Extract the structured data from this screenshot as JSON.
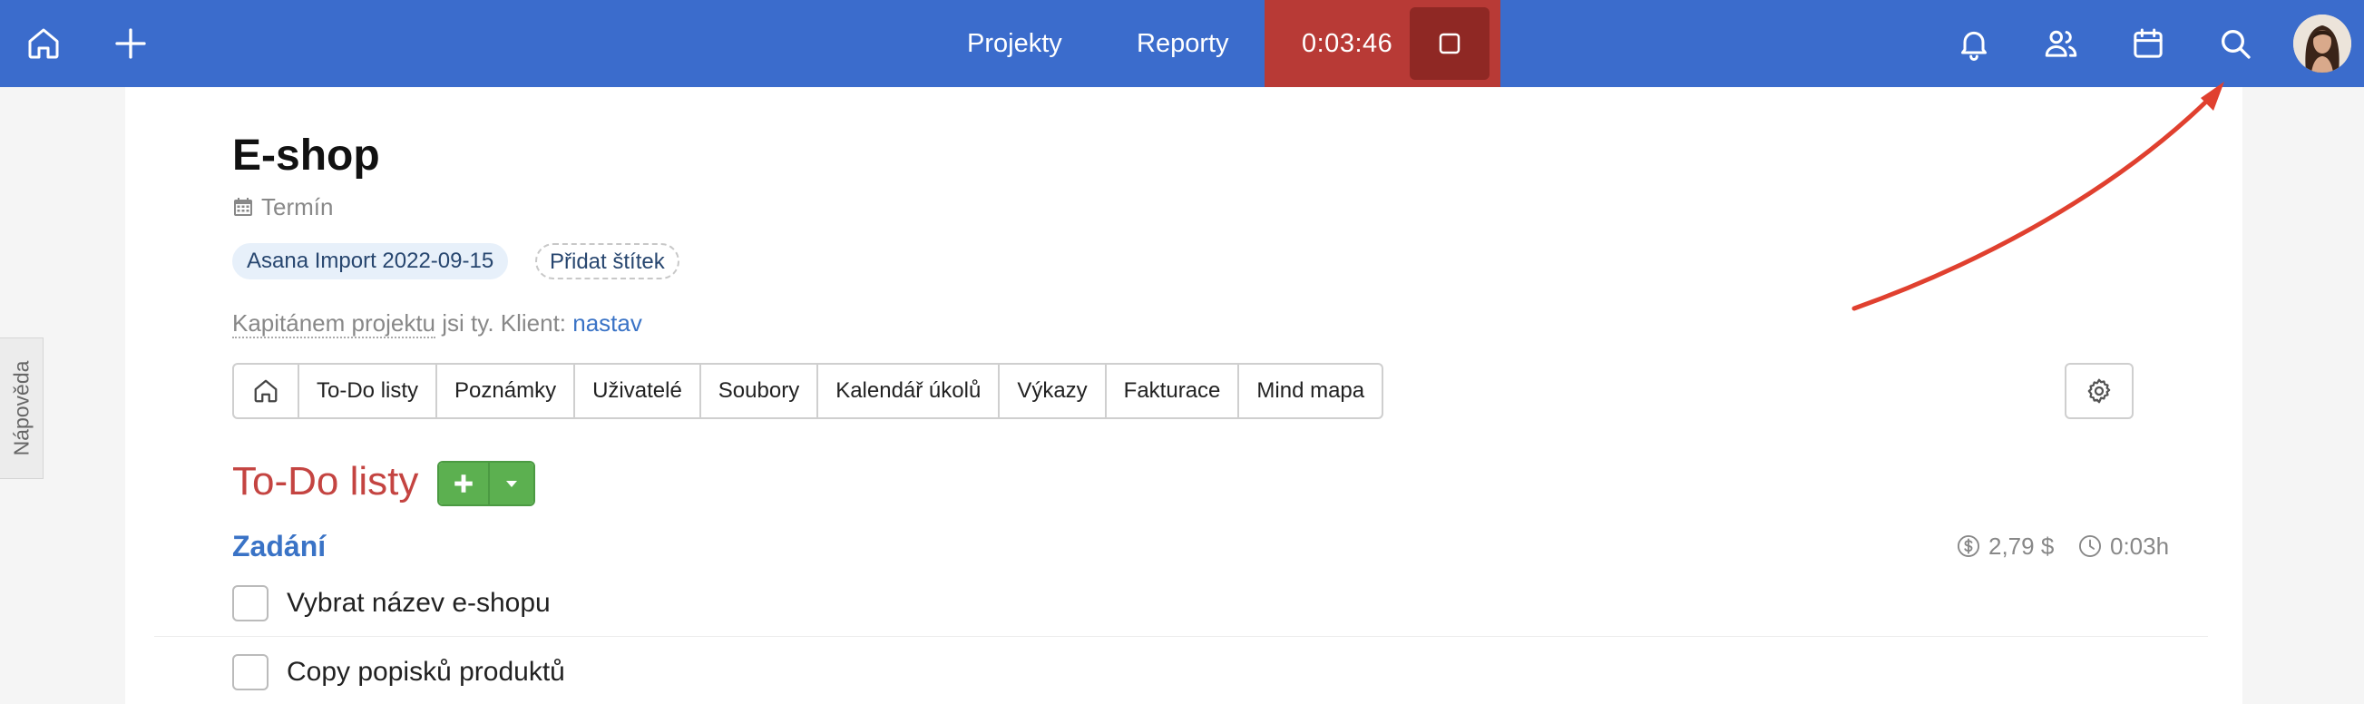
{
  "topbar": {
    "nav": [
      {
        "label": "Projekty"
      },
      {
        "label": "Reporty"
      }
    ],
    "timer": {
      "value": "0:03:46"
    },
    "icons": [
      "home-icon",
      "plus-icon",
      "stop-icon",
      "bell-icon",
      "users-icon",
      "calendar-icon",
      "search-icon"
    ]
  },
  "help": {
    "label": "Nápověda"
  },
  "project": {
    "title": "E-shop",
    "deadline_label": "Termín",
    "tags": [
      {
        "label": "Asana Import 2022-09-15"
      }
    ],
    "add_tag_label": "Přidat štítek",
    "captain_text": "Kapitánem projektu",
    "captain_rest": " jsi ty. Klient: ",
    "client_link": "nastav"
  },
  "tabs": [
    {
      "label": "To-Do listy"
    },
    {
      "label": "Poznámky"
    },
    {
      "label": "Uživatelé"
    },
    {
      "label": "Soubory"
    },
    {
      "label": "Kalendář úkolů"
    },
    {
      "label": "Výkazy"
    },
    {
      "label": "Fakturace"
    },
    {
      "label": "Mind mapa"
    }
  ],
  "section": {
    "title": "To-Do listy"
  },
  "list": {
    "title": "Zadání",
    "cost": "2,79 $",
    "time": "0:03h",
    "items": [
      {
        "label": "Vybrat název e-shopu"
      },
      {
        "label": "Copy popisků produktů"
      }
    ]
  },
  "colors": {
    "topbar": "#3b6ccc",
    "timer": "#b83a36",
    "accent_red": "#c44441",
    "link_blue": "#3a73c6",
    "add_green": "#5cb050",
    "annotation": "#e0402f"
  }
}
